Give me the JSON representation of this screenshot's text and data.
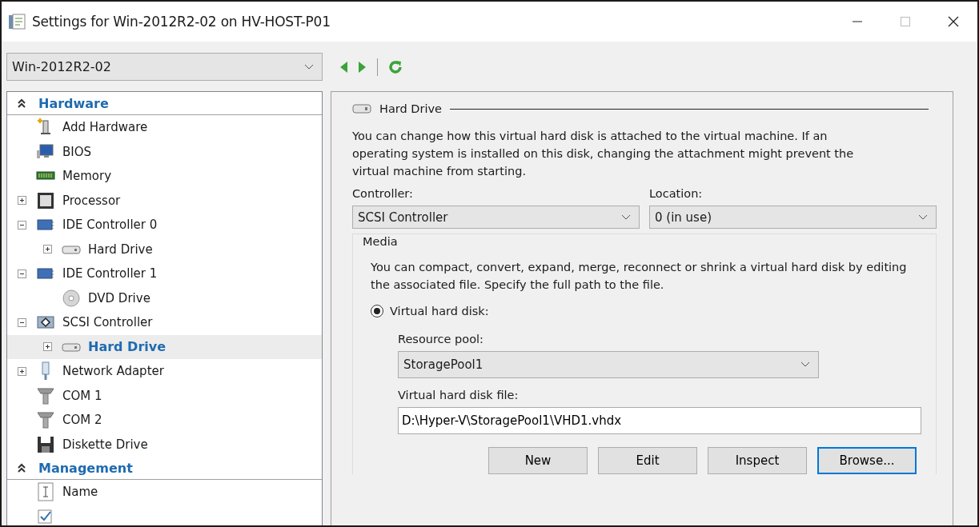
{
  "window": {
    "title": "Settings for Win-2012R2-02 on HV-HOST-P01",
    "controls": [
      {
        "kind": "minimize",
        "disabled": false
      },
      {
        "kind": "maximize",
        "disabled": true
      },
      {
        "kind": "close",
        "disabled": false
      }
    ]
  },
  "vm_selector": {
    "value": "Win-2012R2-02"
  },
  "nav": [
    {
      "kind": "back",
      "disabled": false
    },
    {
      "kind": "forward",
      "disabled": false
    },
    {
      "kind": "refresh",
      "disabled": false
    }
  ],
  "tree": [
    {
      "kind": "section",
      "label": "Hardware",
      "expanded": true,
      "children": [
        {
          "label": "Add Hardware",
          "kind": "add-hardware",
          "selected": false
        },
        {
          "label": "BIOS",
          "kind": "bios",
          "selected": false
        },
        {
          "label": "Memory",
          "kind": "memory",
          "selected": false
        },
        {
          "label": "Processor",
          "kind": "processor",
          "selected": false,
          "expanded": false
        },
        {
          "label": "IDE Controller 0",
          "kind": "controller",
          "selected": false,
          "expanded": true,
          "children": [
            {
              "label": "Hard Drive",
              "kind": "hard-drive",
              "selected": false,
              "expanded": false
            }
          ]
        },
        {
          "label": "IDE Controller 1",
          "kind": "controller",
          "selected": false,
          "expanded": true,
          "children": [
            {
              "label": "DVD Drive",
              "kind": "dvd",
              "selected": false
            }
          ]
        },
        {
          "label": "SCSI Controller",
          "kind": "scsi",
          "selected": false,
          "expanded": true,
          "children": [
            {
              "label": "Hard Drive",
              "kind": "hard-drive",
              "selected": true,
              "expanded": false
            }
          ]
        },
        {
          "label": "Network Adapter",
          "kind": "network",
          "selected": false,
          "expanded": false
        },
        {
          "label": "COM 1",
          "kind": "com",
          "selected": false
        },
        {
          "label": "COM 2",
          "kind": "com",
          "selected": false
        },
        {
          "label": "Diskette Drive",
          "kind": "diskette",
          "selected": false
        }
      ]
    },
    {
      "kind": "section",
      "label": "Management",
      "expanded": true,
      "children": [
        {
          "label": "Name",
          "kind": "name",
          "selected": false
        },
        {
          "kind": "checklist",
          "selected": false
        }
      ]
    }
  ],
  "detail": {
    "heading": "Hard Drive",
    "description": "You can change how this virtual hard disk is attached to the virtual machine. If an operating system is installed on this disk, changing the attachment might prevent the virtual machine from starting.",
    "controller": {
      "label": "Controller:",
      "value": "SCSI Controller"
    },
    "location": {
      "label": "Location:",
      "value": "0 (in use)"
    },
    "media": {
      "title": "Media",
      "description": "You can compact, convert, expand, merge, reconnect or shrink a virtual hard disk by editing the associated file. Specify the full path to the file.",
      "options": [
        {
          "label": "Virtual hard disk:",
          "selected": true
        }
      ],
      "resource_pool": {
        "label": "Resource pool:",
        "value": "StoragePool1"
      },
      "file": {
        "label": "Virtual hard disk file:",
        "value": "D:\\Hyper-V\\StoragePool1\\VHD1.vhdx"
      },
      "buttons": [
        {
          "label": "New",
          "focused": false
        },
        {
          "label": "Edit",
          "focused": false
        },
        {
          "label": "Inspect",
          "focused": false
        },
        {
          "label": "Browse...",
          "focused": true
        }
      ]
    }
  }
}
